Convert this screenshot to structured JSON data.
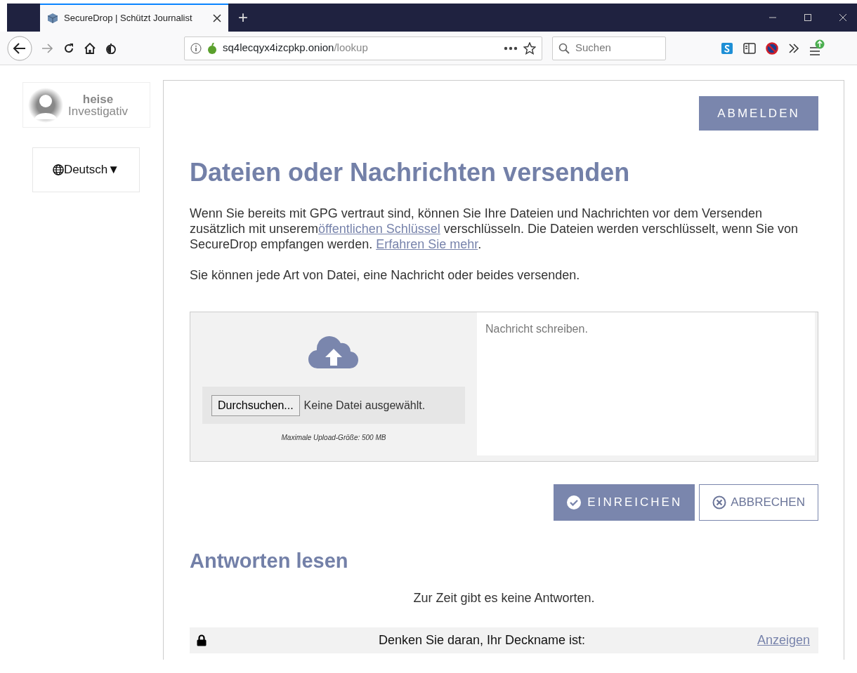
{
  "browser": {
    "tabs": [
      {
        "title": "SecureDrop | Schützt Journalist",
        "selected": true
      }
    ],
    "new_tab": "+",
    "address": {
      "host": "sq4lecqyx4izcpkp.onion",
      "path": "/lookup"
    },
    "search": {
      "placeholder": "Suchen"
    }
  },
  "sidebar": {
    "logo": {
      "line_1": "heise",
      "line_2": "Investigativ"
    },
    "language": {
      "label": "Deutsch",
      "caret": "▼"
    }
  },
  "logout_button": "ABMELDEN",
  "heading": "Dateien oder Nachrichten versenden",
  "intro": [
    {
      "kind": "text",
      "text": "Wenn Sie bereits mit GPG vertraut sind, können Sie Ihre Dateien und Nachrichten vor dem Versenden zusätzlich mit unserem"
    },
    {
      "kind": "link",
      "text": "öffentlichen Schlüssel"
    },
    {
      "kind": "text",
      "text": " verschlüsseln. Die Dateien werden verschlüsselt, wenn Sie von SecureDrop empfangen werden. "
    },
    {
      "kind": "link",
      "text": "Erfahren Sie mehr"
    },
    {
      "kind": "text",
      "text": "."
    }
  ],
  "note": "Sie können jede Art von Datei, eine Nachricht oder beides versenden.",
  "upload": {
    "browse_button": "Durchsuchen...",
    "file_status": "Keine Datei ausgewählt.",
    "max_size": "Maximale Upload-Größe: 500 MB"
  },
  "message": {
    "placeholder": "Nachricht schreiben."
  },
  "buttons": [
    {
      "kind": "primary",
      "label": "EINREICHEN"
    },
    {
      "kind": "secondary",
      "label": "ABBRECHEN"
    }
  ],
  "replies": {
    "heading": "Antworten lesen",
    "empty": "Zur Zeit gibt es keine Antworten."
  },
  "codename_bar": {
    "text": "Denken Sie daran, Ihr Deckname ist:",
    "link": "Anzeigen"
  }
}
